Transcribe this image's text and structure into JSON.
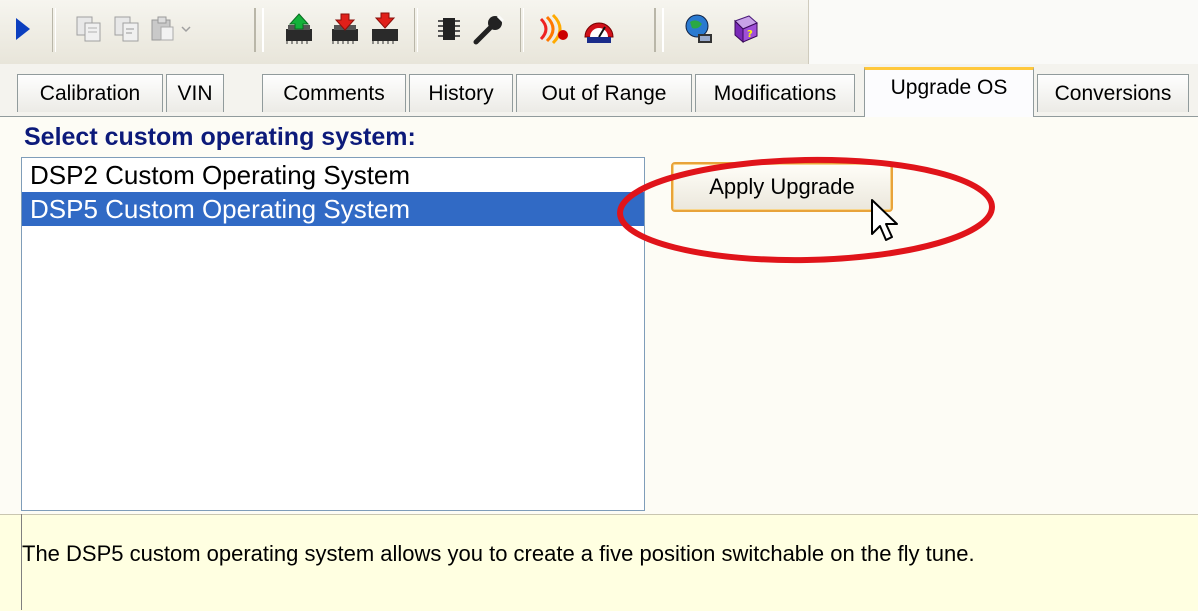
{
  "toolbar": {
    "icons": [
      "play-icon",
      "copy-icon",
      "copy-format-icon",
      "paste-icon",
      "paste-dropdown-icon",
      "upload-green-icon",
      "download-red-icon",
      "download-red-alt-icon",
      "chip-icon",
      "wrench-icon",
      "signal-tool-icon",
      "gauge-icon",
      "globe-network-icon",
      "help-book-icon"
    ]
  },
  "tabs": [
    {
      "label": "Calibration"
    },
    {
      "label": "VIN"
    },
    {
      "label": "Comments"
    },
    {
      "label": "History"
    },
    {
      "label": "Out of Range"
    },
    {
      "label": "Modifications"
    },
    {
      "label": "Upgrade OS",
      "active": true
    },
    {
      "label": "Conversions"
    }
  ],
  "main": {
    "heading": "Select custom operating system:",
    "os_list": [
      {
        "label": "DSP2 Custom Operating System",
        "selected": false
      },
      {
        "label": "DSP5 Custom Operating System",
        "selected": true
      }
    ],
    "apply_button": "Apply Upgrade",
    "description": "The DSP5 custom operating system allows you to create a five position switchable on the fly tune."
  },
  "colors": {
    "heading": "#0c1a7a",
    "selection": "#316ac5",
    "annotation_circle": "#e0141a",
    "active_tab_accent": "#ffc83c",
    "description_bg": "#ffffe1"
  }
}
